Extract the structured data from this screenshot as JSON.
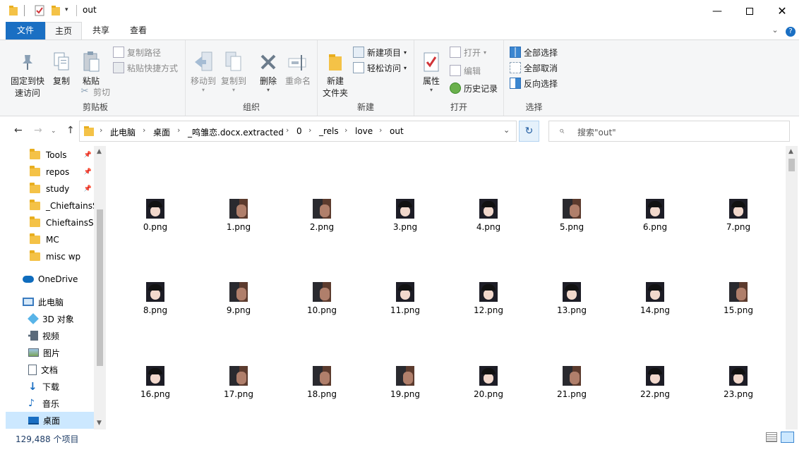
{
  "window": {
    "title": "out"
  },
  "tabs": {
    "file": "文件",
    "home": "主页",
    "share": "共享",
    "view": "查看"
  },
  "ribbon": {
    "clipboard": {
      "label": "剪贴板",
      "pin": "固定到快\n速访问",
      "copy": "复制",
      "paste": "粘贴",
      "copy_path": "复制路径",
      "paste_shortcut": "粘贴快捷方式",
      "cut": "剪切"
    },
    "organize": {
      "label": "组织",
      "move_to": "移动到",
      "copy_to": "复制到",
      "delete": "删除",
      "rename": "重命名"
    },
    "new": {
      "label": "新建",
      "new_folder": "新建\n文件夹",
      "new_item": "新建项目",
      "easy_access": "轻松访问"
    },
    "open": {
      "label": "打开",
      "properties": "属性",
      "open": "打开",
      "edit": "编辑",
      "history": "历史记录"
    },
    "select": {
      "label": "选择",
      "select_all": "全部选择",
      "select_none": "全部取消",
      "invert": "反向选择"
    }
  },
  "address": {
    "crumbs": [
      "此电脑",
      "桌面",
      "_鸣雏恋.docx.extracted",
      "0",
      "_rels",
      "love",
      "out"
    ]
  },
  "search": {
    "placeholder": "搜索\"out\""
  },
  "nav": {
    "quick": [
      "Tools",
      "repos",
      "study",
      "_ChieftainsSe",
      "ChieftainsSec",
      "MC",
      "misc wp"
    ],
    "onedrive": "OneDrive",
    "thispc": "此电脑",
    "pc_items": [
      "3D 对象",
      "视频",
      "图片",
      "文档",
      "下载",
      "音乐",
      "桌面"
    ]
  },
  "files": [
    "0.png",
    "1.png",
    "2.png",
    "3.png",
    "4.png",
    "5.png",
    "6.png",
    "7.png",
    "8.png",
    "9.png",
    "10.png",
    "11.png",
    "12.png",
    "13.png",
    "14.png",
    "15.png",
    "16.png",
    "17.png",
    "18.png",
    "19.png",
    "20.png",
    "21.png",
    "22.png",
    "23.png"
  ],
  "status": {
    "count": "129,488 个项目"
  },
  "colors": {
    "accent": "#1a6fc3",
    "selected": "#cce8ff"
  }
}
